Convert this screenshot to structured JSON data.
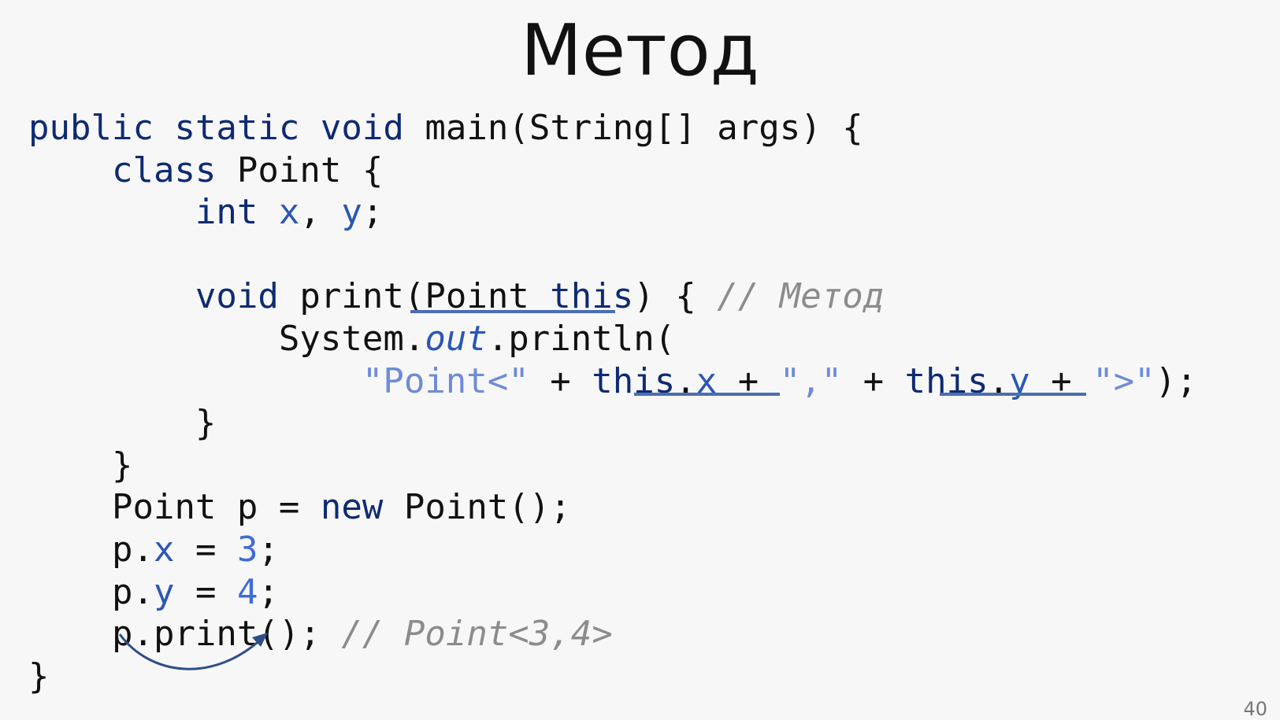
{
  "slide": {
    "title": "Метод",
    "page_number": "40",
    "code": {
      "l1": {
        "kw1": "public",
        "kw2": "static",
        "kw3": "void",
        "rest": "main(String[] args) {"
      },
      "l2": {
        "kw": "class",
        "rest": "Point {"
      },
      "l3": {
        "kw": "int",
        "f1": "x",
        "f2": "y"
      },
      "l5": {
        "kw": "void",
        "a": "print(",
        "b": "Point ",
        "c": "this",
        "d": ") {",
        "cmt": "// Метод"
      },
      "l6": {
        "a": "System.",
        "b": "out",
        "c": ".println("
      },
      "l7": {
        "s1": "\"Point<\"",
        "t1": "this",
        "f1": "x",
        "s2": "\",\"",
        "t2": "this",
        "f2": "y",
        "s3": "\">\"",
        "end": ");"
      },
      "l8": "}",
      "l9": "}",
      "l10": {
        "a": "Point p = ",
        "kw": "new",
        "b": " Point();"
      },
      "l11": {
        "a": "p.",
        "f": "x",
        "b": " = ",
        "n": "3",
        "c": ";"
      },
      "l12": {
        "a": "p.",
        "f": "y",
        "b": " = ",
        "n": "4",
        "c": ";"
      },
      "l13": {
        "a": "p.print();",
        "cmt": "// Point<3,4>"
      },
      "l14": "}"
    }
  }
}
